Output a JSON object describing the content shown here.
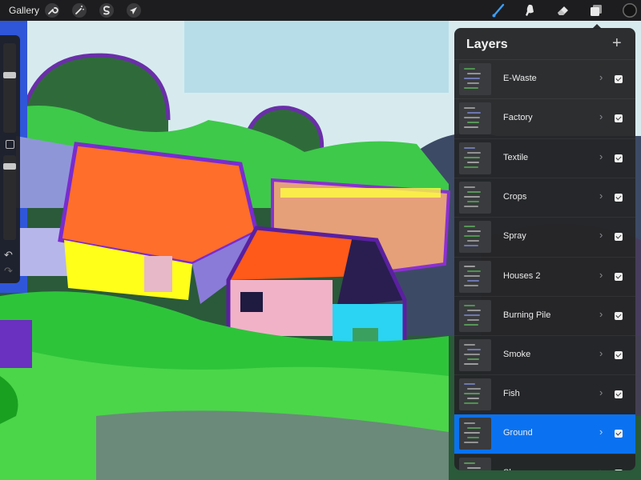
{
  "toolbar": {
    "gallery_label": "Gallery",
    "left_icons": [
      "wrench-icon",
      "magic-wand-icon",
      "selection-icon",
      "transform-icon"
    ],
    "right_icons": [
      "brush-icon",
      "smudge-icon",
      "eraser-icon",
      "layers-icon"
    ],
    "active_tool": "brush",
    "active_tool_color": "#3aa0ff",
    "current_color": "#141414"
  },
  "sidebar": {
    "brush_size_level": 0.16,
    "opacity_level": 0.06
  },
  "layers_panel": {
    "title": "Layers",
    "add_label": "+",
    "accent_color": "#0a72f0",
    "layers": [
      {
        "name": "E-Waste",
        "visible": true,
        "selected": false
      },
      {
        "name": "Factory",
        "visible": true,
        "selected": false
      },
      {
        "name": "Textile",
        "visible": true,
        "selected": false
      },
      {
        "name": "Crops",
        "visible": true,
        "selected": false
      },
      {
        "name": "Spray",
        "visible": true,
        "selected": false
      },
      {
        "name": "Houses 2",
        "visible": true,
        "selected": false
      },
      {
        "name": "Burning Pile",
        "visible": true,
        "selected": false
      },
      {
        "name": "Smoke",
        "visible": true,
        "selected": false
      },
      {
        "name": "Fish",
        "visible": true,
        "selected": false
      },
      {
        "name": "Ground",
        "visible": true,
        "selected": true
      },
      {
        "name": "Sky",
        "visible": true,
        "selected": false
      }
    ]
  }
}
